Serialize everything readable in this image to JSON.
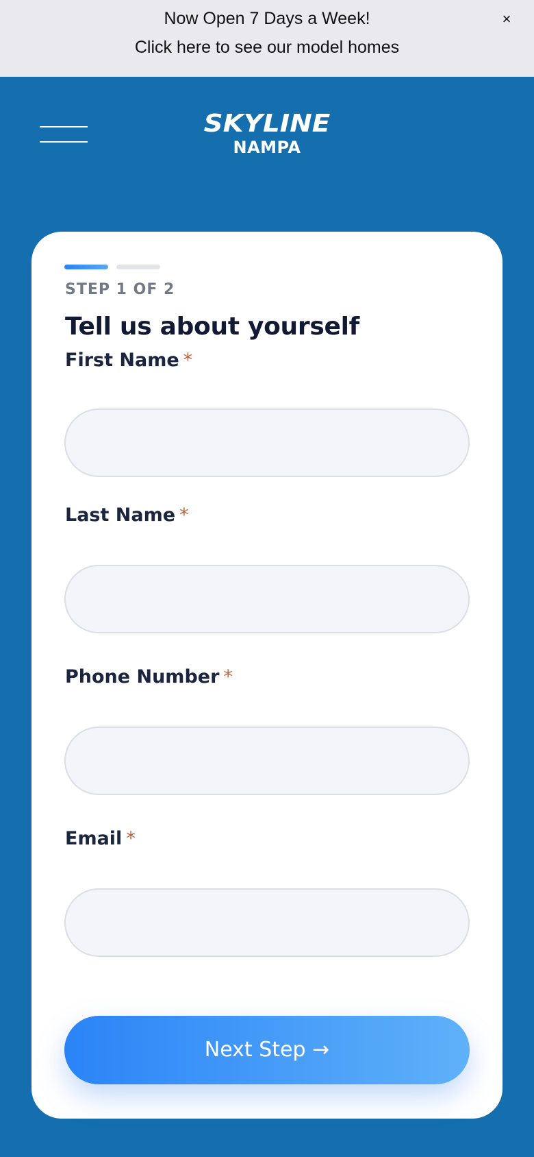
{
  "announcement": {
    "line1": "Now Open 7 Days a Week!",
    "line2": "Click here to see our model homes",
    "close_glyph": "×"
  },
  "header": {
    "logo_line1": "SKYLINE",
    "logo_line2": "NAMPA",
    "menu_icon": "hamburger-icon"
  },
  "form": {
    "step_label": "STEP 1 OF 2",
    "progress": {
      "current_step": 1,
      "total_steps": 2
    },
    "heading": "Tell us about yourself",
    "fields": [
      {
        "label": "First Name",
        "required_mark": "*",
        "value": ""
      },
      {
        "label": "Last Name",
        "required_mark": "*",
        "value": ""
      },
      {
        "label": "Phone Number",
        "required_mark": "*",
        "value": ""
      },
      {
        "label": "Email",
        "required_mark": "*",
        "value": ""
      }
    ],
    "next_button": "Next Step →"
  },
  "colors": {
    "page_background": "#156fae",
    "accent": "#2b84f7",
    "required": "#c0643c"
  }
}
